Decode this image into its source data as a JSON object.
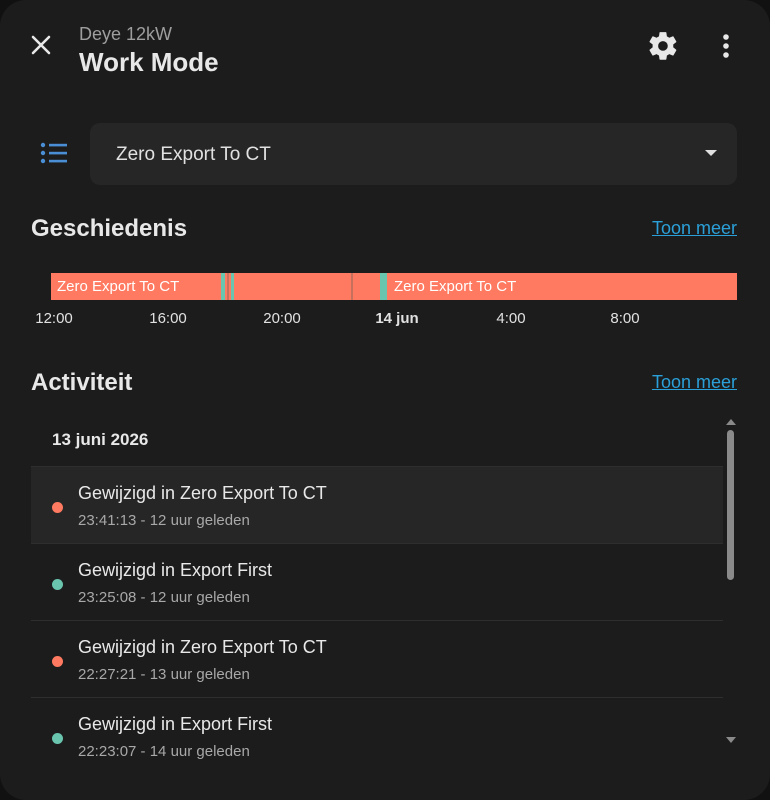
{
  "header": {
    "subtitle": "Deye 12kW",
    "title": "Work Mode",
    "close_icon": "close-icon",
    "settings_icon": "gear-icon",
    "more_icon": "more-vertical-icon"
  },
  "select": {
    "icon": "list-icon",
    "value": "Zero Export To CT"
  },
  "history": {
    "title": "Geschiedenis",
    "more_link": "Toon meer",
    "timeline_labels": [
      "Zero Export To CT",
      "Zero Export To CT"
    ],
    "ticks": [
      "12:00",
      "16:00",
      "20:00",
      "14 jun",
      "4:00",
      "8:00"
    ],
    "colors": {
      "zero_export": "#ff7a60",
      "export_first": "#69c5ae"
    }
  },
  "activity": {
    "title": "Activiteit",
    "more_link": "Toon meer",
    "date": "13 juni 2026",
    "items": [
      {
        "message": "Gewijzigd in Zero Export To CT",
        "time": "23:41:13 - 12 uur geleden",
        "color": "#ff7a60"
      },
      {
        "message": "Gewijzigd in Export First",
        "time": "23:25:08 - 12 uur geleden",
        "color": "#69c5ae"
      },
      {
        "message": "Gewijzigd in Zero Export To CT",
        "time": "22:27:21 - 13 uur geleden",
        "color": "#ff7a60"
      },
      {
        "message": "Gewijzigd in Export First",
        "time": "22:23:07 - 14 uur geleden",
        "color": "#69c5ae"
      }
    ]
  }
}
